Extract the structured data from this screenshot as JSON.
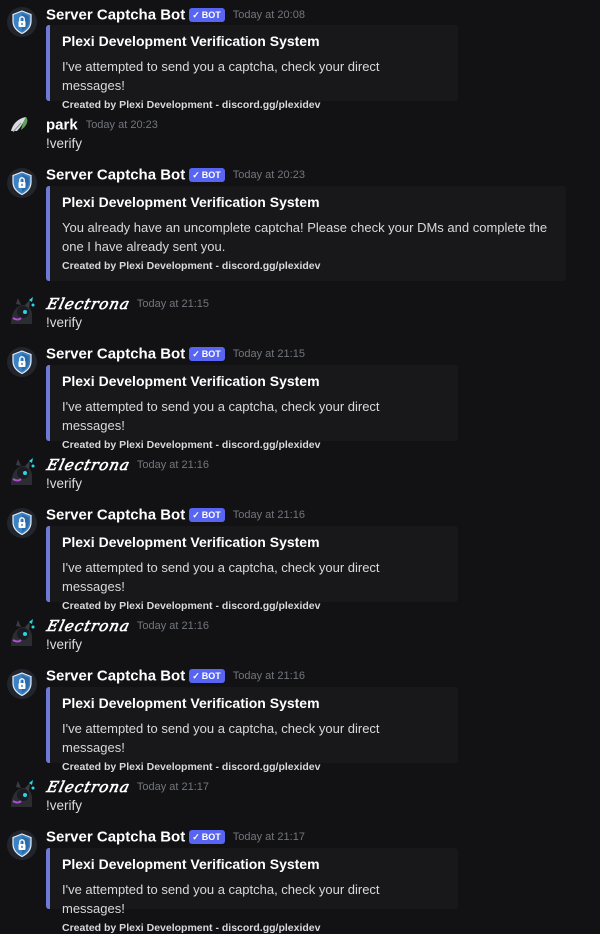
{
  "bot": {
    "name": "Server Captcha Bot",
    "badge": "BOT",
    "avatar_icon": "shield-lock-icon",
    "accent": "#5865f2"
  },
  "embed_common": {
    "title": "Plexi Development Verification System",
    "footer": "Created by Plexi Development - discord.gg/plexidev",
    "border_color": "#6d7bd6"
  },
  "messages": [
    {
      "type": "bot",
      "timestamp": "Today at 20:08",
      "description": "I've attempted to send you a captcha, check your direct messages!"
    },
    {
      "type": "user",
      "author": "park",
      "timestamp": "Today at 20:23",
      "content": "!verify"
    },
    {
      "type": "bot",
      "timestamp": "Today at 20:23",
      "description": "You already have an uncomplete captcha! Please check your DMs and complete the one I have already sent you."
    },
    {
      "type": "user",
      "author": "𝐸𝑙𝑒𝑐𝑡𝑟𝑜𝑛𝑎",
      "timestamp": "Today at 21:15",
      "content": "!verify"
    },
    {
      "type": "bot",
      "timestamp": "Today at 21:15",
      "description": "I've attempted to send you a captcha, check your direct messages!"
    },
    {
      "type": "user",
      "author": "𝐸𝑙𝑒𝑐𝑡𝑟𝑜𝑛𝑎",
      "timestamp": "Today at 21:16",
      "content": "!verify"
    },
    {
      "type": "bot",
      "timestamp": "Today at 21:16",
      "description": "I've attempted to send you a captcha, check your direct messages!"
    },
    {
      "type": "user",
      "author": "𝐸𝑙𝑒𝑐𝑡𝑟𝑜𝑛𝑎",
      "timestamp": "Today at 21:16",
      "content": "!verify"
    },
    {
      "type": "bot",
      "timestamp": "Today at 21:16",
      "description": "I've attempted to send you a captcha, check your direct messages!"
    },
    {
      "type": "user",
      "author": "𝐸𝑙𝑒𝑐𝑡𝑟𝑜𝑛𝑎",
      "timestamp": "Today at 21:17",
      "content": "!verify"
    },
    {
      "type": "bot",
      "timestamp": "Today at 21:17",
      "description": "I've attempted to send you a captcha, check your direct messages!"
    }
  ]
}
